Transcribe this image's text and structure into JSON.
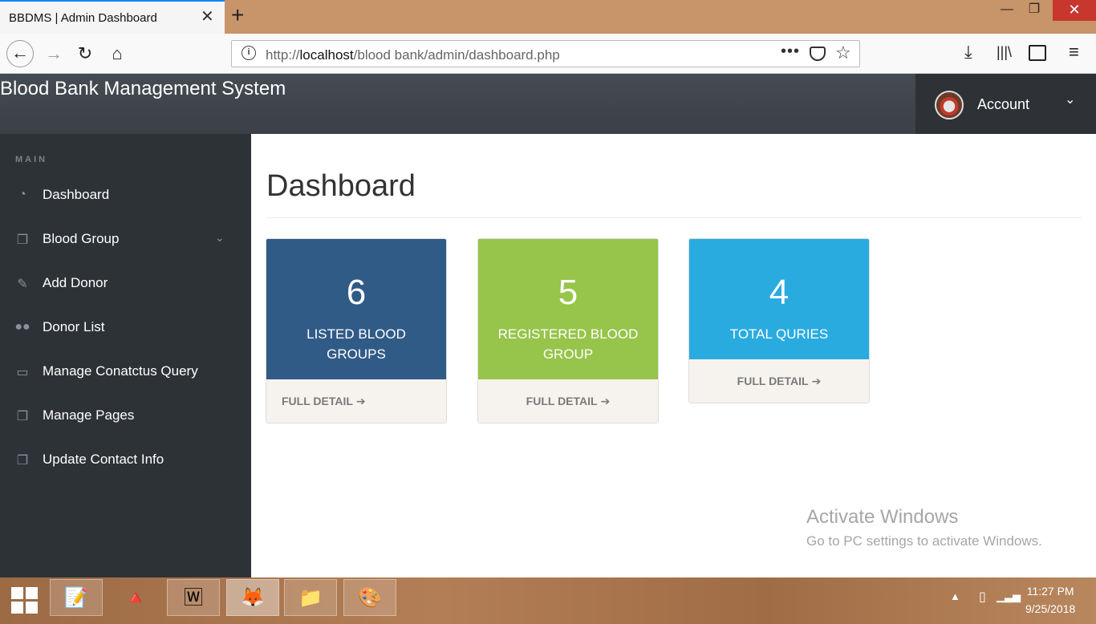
{
  "browser": {
    "tab_title": "BBDMS | Admin Dashboard",
    "tab_close": "✕",
    "new_tab": "+",
    "url_prefix": "http://",
    "url_host": "localhost",
    "url_path": "/blood bank/admin/dashboard.php"
  },
  "header": {
    "brand": "Blood Bank Management System",
    "account_label": "Account"
  },
  "sidebar": {
    "heading": "MAIN",
    "items": [
      {
        "label": "Dashboard",
        "icon": "dashboard-icon"
      },
      {
        "label": "Blood Group",
        "icon": "copy-icon",
        "has_submenu": true
      },
      {
        "label": "Add Donor",
        "icon": "edit-icon"
      },
      {
        "label": "Donor List",
        "icon": "users-icon"
      },
      {
        "label": "Manage Conatctus Query",
        "icon": "desktop-icon"
      },
      {
        "label": "Manage Pages",
        "icon": "copy-icon"
      },
      {
        "label": "Update Contact Info",
        "icon": "copy-icon"
      }
    ]
  },
  "main": {
    "title": "Dashboard",
    "cards": [
      {
        "count": "6",
        "label": "LISTED BLOOD GROUPS",
        "footer": "FULL DETAIL",
        "color": "#315b87"
      },
      {
        "count": "5",
        "label": "REGISTERED BLOOD GROUP",
        "footer": "FULL DETAIL",
        "color": "#97c44a"
      },
      {
        "count": "4",
        "label": "TOTAL QURIES",
        "footer": "FULL DETAIL",
        "color": "#2aabe0"
      }
    ]
  },
  "watermark": {
    "title": "Activate Windows",
    "subtitle": "Go to PC settings to activate Windows."
  },
  "taskbar": {
    "time": "11:27 PM",
    "date": "9/25/2018"
  }
}
